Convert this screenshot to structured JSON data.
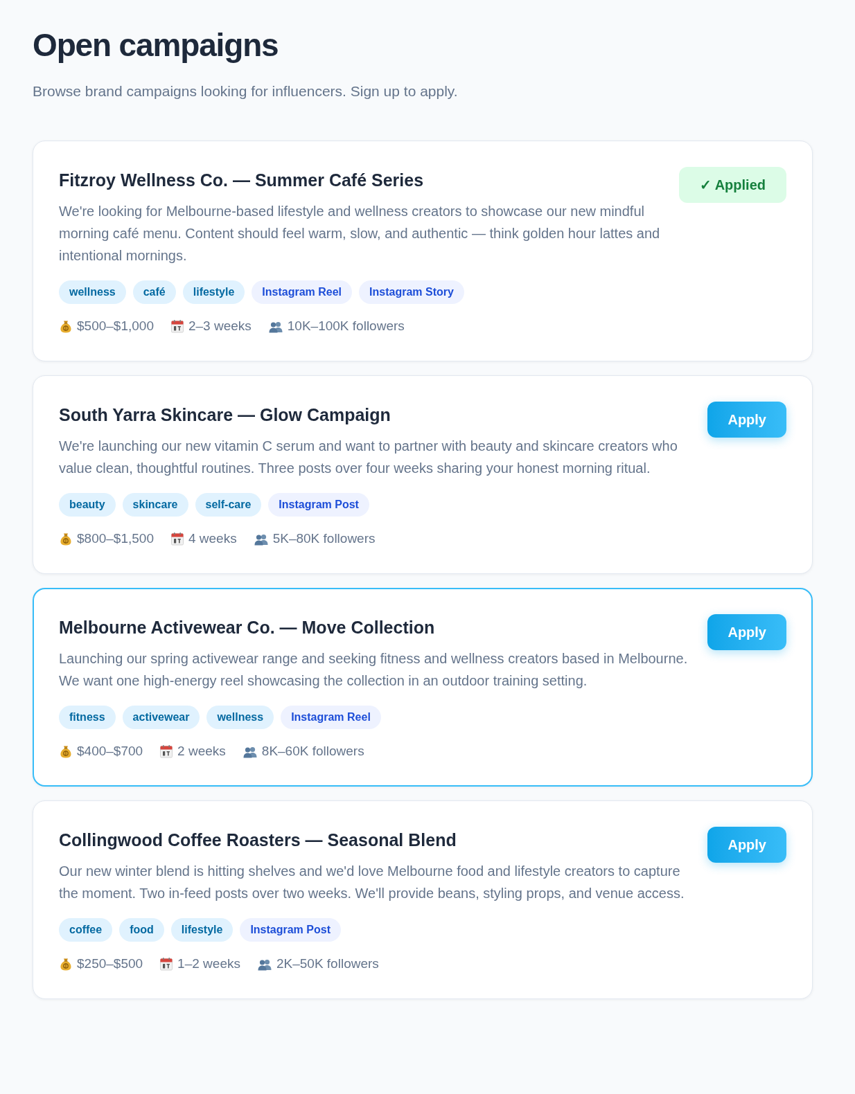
{
  "page": {
    "title": "Open campaigns",
    "subtitle": "Browse brand campaigns looking for influencers. Sign up to apply."
  },
  "campaigns": [
    {
      "title": "Fitzroy Wellness Co. — Summer Café Series",
      "description": "We're looking for Melbourne-based lifestyle and wellness creators to showcase our new mindful morning café menu. Content should feel warm, slow, and authentic — think golden hour lattes and intentional mornings.",
      "highlighted": false,
      "applied": true,
      "action": "✓ Applied",
      "tags": [
        {
          "label": "wellness",
          "kind": "topic"
        },
        {
          "label": "café",
          "kind": "topic"
        },
        {
          "label": "lifestyle",
          "kind": "topic"
        },
        {
          "label": "Instagram Reel",
          "kind": "format"
        },
        {
          "label": "Instagram Story",
          "kind": "format"
        }
      ],
      "meta": [
        {
          "kind": "budget",
          "text": "$500–$1,000"
        },
        {
          "kind": "duration",
          "text": "2–3 weeks"
        },
        {
          "kind": "audience",
          "text": "10K–100K followers"
        }
      ]
    },
    {
      "title": "South Yarra Skincare — Glow Campaign",
      "description": "We're launching our new vitamin C serum and want to partner with beauty and skincare creators who value clean, thoughtful routines. Three posts over four weeks sharing your honest morning ritual.",
      "highlighted": false,
      "applied": false,
      "action": "Apply",
      "tags": [
        {
          "label": "beauty",
          "kind": "topic"
        },
        {
          "label": "skincare",
          "kind": "topic"
        },
        {
          "label": "self-care",
          "kind": "topic"
        },
        {
          "label": "Instagram Post",
          "kind": "format"
        }
      ],
      "meta": [
        {
          "kind": "budget",
          "text": "$800–$1,500"
        },
        {
          "kind": "duration",
          "text": "4 weeks"
        },
        {
          "kind": "audience",
          "text": "5K–80K followers"
        }
      ]
    },
    {
      "title": "Melbourne Activewear Co. — Move Collection",
      "description": "Launching our spring activewear range and seeking fitness and wellness creators based in Melbourne. We want one high-energy reel showcasing the collection in an outdoor training setting.",
      "highlighted": true,
      "applied": false,
      "action": "Apply",
      "tags": [
        {
          "label": "fitness",
          "kind": "topic"
        },
        {
          "label": "activewear",
          "kind": "topic"
        },
        {
          "label": "wellness",
          "kind": "topic"
        },
        {
          "label": "Instagram Reel",
          "kind": "format"
        }
      ],
      "meta": [
        {
          "kind": "budget",
          "text": "$400–$700"
        },
        {
          "kind": "duration",
          "text": "2 weeks"
        },
        {
          "kind": "audience",
          "text": "8K–60K followers"
        }
      ]
    },
    {
      "title": "Collingwood Coffee Roasters — Seasonal Blend",
      "description": "Our new winter blend is hitting shelves and we'd love Melbourne food and lifestyle creators to capture the moment. Two in-feed posts over two weeks. We'll provide beans, styling props, and venue access.",
      "highlighted": false,
      "applied": false,
      "action": "Apply",
      "tags": [
        {
          "label": "coffee",
          "kind": "topic"
        },
        {
          "label": "food",
          "kind": "topic"
        },
        {
          "label": "lifestyle",
          "kind": "topic"
        },
        {
          "label": "Instagram Post",
          "kind": "format"
        }
      ],
      "meta": [
        {
          "kind": "budget",
          "text": "$250–$500"
        },
        {
          "kind": "duration",
          "text": "1–2 weeks"
        },
        {
          "kind": "audience",
          "text": "2K–50K followers"
        }
      ]
    }
  ]
}
